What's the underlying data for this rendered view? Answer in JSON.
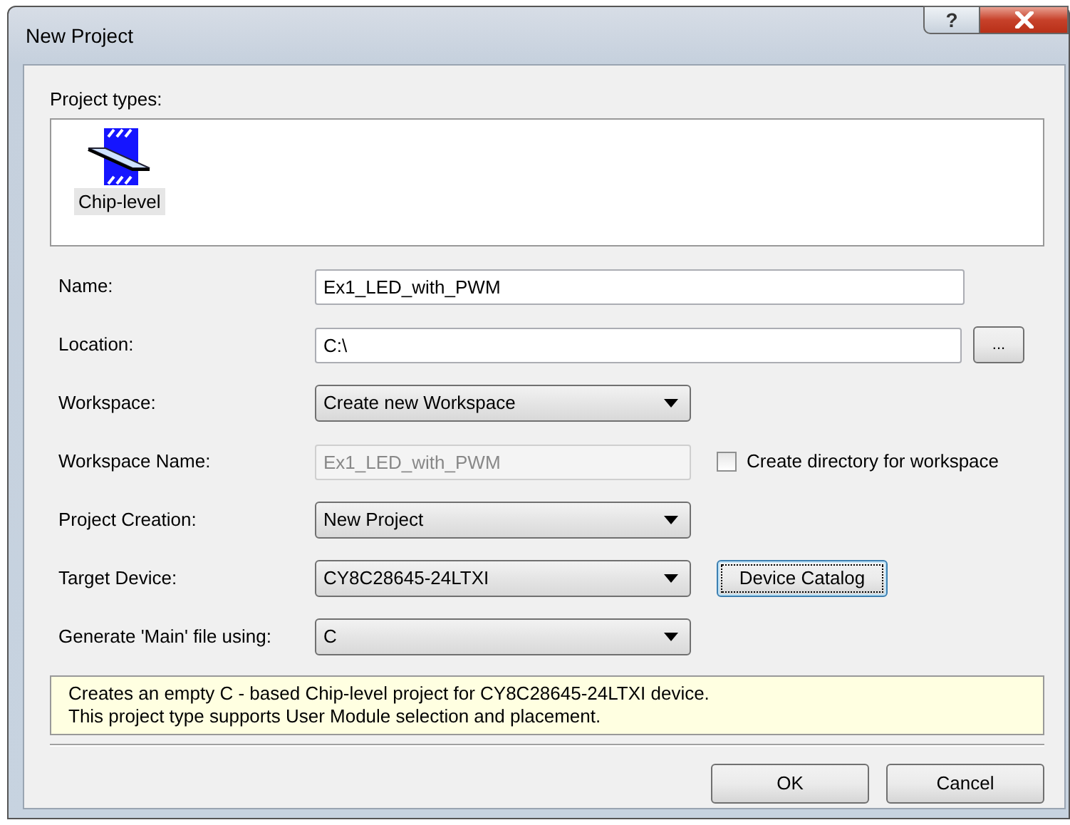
{
  "window": {
    "title": "New Project",
    "title_buttons": [
      {
        "kind": "help",
        "label": "?"
      },
      {
        "kind": "close"
      }
    ]
  },
  "project_types": {
    "label": "Project types:",
    "items": [
      {
        "label": "Chip-level",
        "selected": true
      }
    ]
  },
  "fields": [
    {
      "kind": "text",
      "label": "Name:",
      "value": "Ex1_LED_with_PWM",
      "disabled": false
    },
    {
      "kind": "text",
      "label": "Location:",
      "value": "C:\\",
      "disabled": false,
      "button": {
        "label": "...",
        "focused": false
      }
    },
    {
      "kind": "combo",
      "label": "Workspace:",
      "value": "Create new Workspace",
      "disabled": false
    },
    {
      "kind": "text",
      "label": "Workspace Name:",
      "value": "Ex1_LED_with_PWM",
      "disabled": true,
      "checkbox": {
        "label": "Create directory for workspace",
        "checked": false
      }
    },
    {
      "kind": "combo",
      "label": "Project Creation:",
      "value": "New Project",
      "disabled": false
    },
    {
      "kind": "combo",
      "label": "Target Device:",
      "value": "CY8C28645-24LTXI",
      "disabled": false,
      "button": {
        "label": "Device Catalog",
        "focused": true
      }
    },
    {
      "kind": "combo",
      "label": "Generate 'Main' file using:",
      "value": "C",
      "disabled": false
    }
  ],
  "description": [
    "Creates an empty C - based Chip-level project for CY8C28645-24LTXI device.",
    "This project type supports User Module selection and placement."
  ],
  "buttons": [
    {
      "label": "OK"
    },
    {
      "label": "Cancel"
    }
  ]
}
